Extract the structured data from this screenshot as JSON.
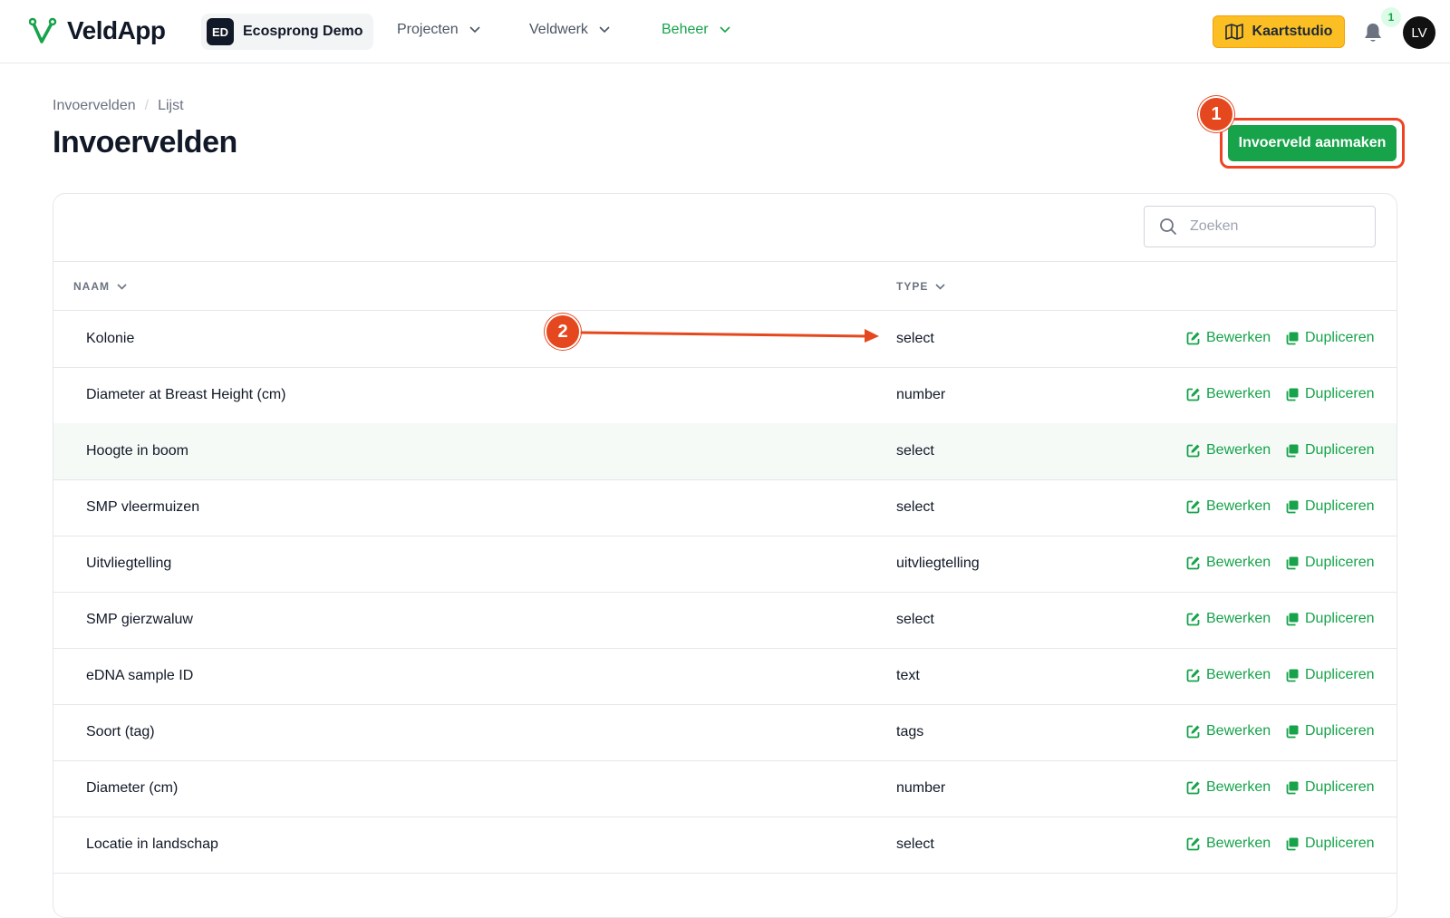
{
  "app": {
    "name": "VeldApp"
  },
  "org": {
    "initials": "ED",
    "name": "Ecosprong Demo"
  },
  "nav": [
    {
      "label": "Projecten"
    },
    {
      "label": "Veldwerk"
    },
    {
      "label": "Beheer"
    }
  ],
  "header": {
    "map_studio_label": "Kaartstudio",
    "notification_count": "1",
    "user_initials": "LV"
  },
  "breadcrumb": [
    "Invoervelden",
    "Lijst"
  ],
  "page": {
    "title": "Invoervelden",
    "create_label": "Invoerveld aanmaken"
  },
  "search": {
    "placeholder": "Zoeken"
  },
  "table": {
    "columns": [
      "NAAM",
      "TYPE"
    ],
    "edit_label": "Bewerken",
    "duplicate_label": "Dupliceren",
    "rows": [
      {
        "name": "Kolonie",
        "type": "select"
      },
      {
        "name": "Diameter at Breast Height (cm)",
        "type": "number"
      },
      {
        "name": "Hoogte in boom",
        "type": "select"
      },
      {
        "name": "SMP vleermuizen",
        "type": "select"
      },
      {
        "name": "Uitvliegtelling",
        "type": "uitvliegtelling"
      },
      {
        "name": "SMP gierzwaluw",
        "type": "select"
      },
      {
        "name": "eDNA sample ID",
        "type": "text"
      },
      {
        "name": "Soort (tag)",
        "type": "tags"
      },
      {
        "name": "Diameter (cm)",
        "type": "number"
      },
      {
        "name": "Locatie in landschap",
        "type": "select"
      }
    ]
  },
  "annotations": {
    "marker_1": "1",
    "marker_2": "2"
  },
  "colors": {
    "brand_green": "#16a34a",
    "accent_yellow": "#fbbf24",
    "annotation_red": "#e5481e"
  }
}
